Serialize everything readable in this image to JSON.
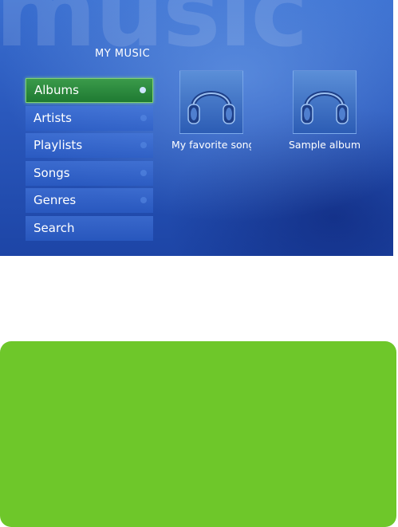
{
  "watermark": "music",
  "section_title": "MY MUSIC",
  "menu": [
    {
      "label": "Albums",
      "selected": true,
      "has_dot": true
    },
    {
      "label": "Artists",
      "selected": false,
      "has_dot": true
    },
    {
      "label": "Playlists",
      "selected": false,
      "has_dot": true
    },
    {
      "label": "Songs",
      "selected": false,
      "has_dot": true
    },
    {
      "label": "Genres",
      "selected": false,
      "has_dot": true
    },
    {
      "label": "Search",
      "selected": false,
      "has_dot": false
    }
  ],
  "albums": [
    {
      "caption": "My favorite songs",
      "icon": "headphones-icon"
    },
    {
      "caption": "Sample album",
      "icon": "headphones-icon"
    }
  ],
  "colors": {
    "background_blue": "#2a58bc",
    "selection_green": "#2a8a3c",
    "panel_green": "#6ec72a"
  }
}
